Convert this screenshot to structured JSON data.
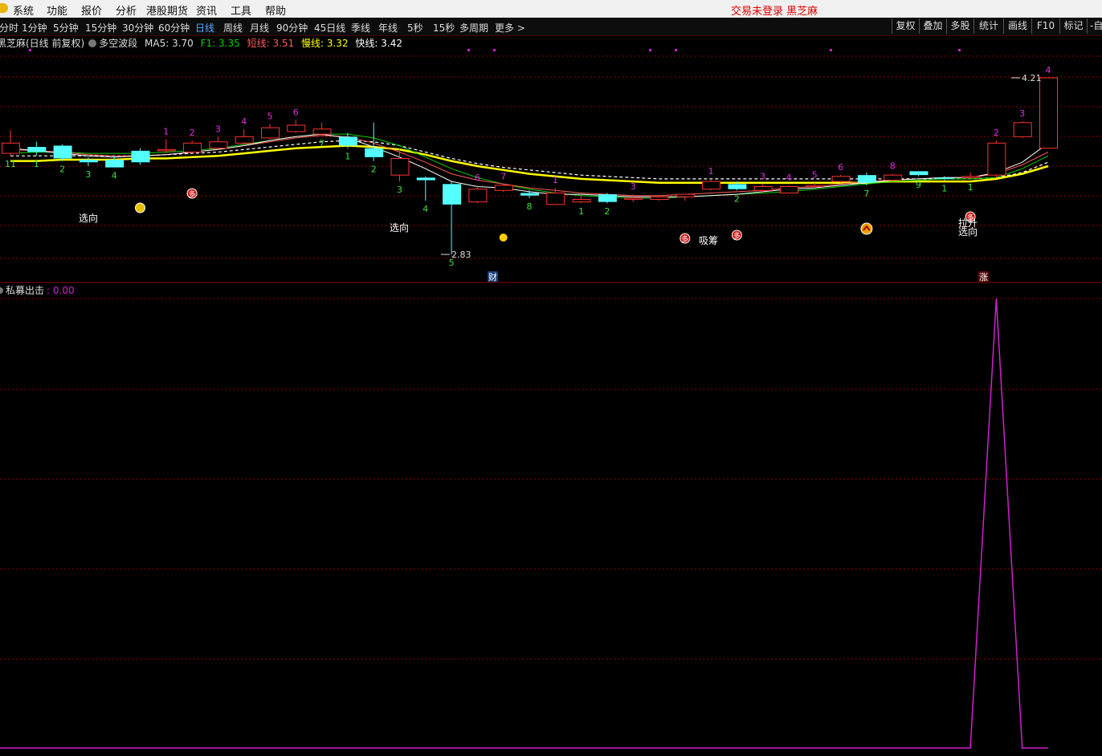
{
  "menubar": {
    "items": [
      "系统",
      "功能",
      "报价",
      "分析",
      "港股期货",
      "资讯",
      "工具",
      "帮助"
    ],
    "status_text": "交易未登录 黑芝麻"
  },
  "toolbar": {
    "periods": [
      "分时",
      "1分钟",
      "5分钟",
      "15分钟",
      "30分钟",
      "60分钟",
      "日线",
      "周线",
      "月线",
      "90分钟",
      "45日线",
      "季线",
      "年线",
      "5秒",
      "15秒",
      "多周期",
      "更多 >"
    ],
    "active": "日线",
    "right_buttons": [
      "复权",
      "叠加",
      "多股",
      "统计",
      "画线",
      "F10",
      "标记",
      "-自"
    ]
  },
  "info": {
    "title": "黑芝麻(日线 前复权)",
    "indicator_name": "多空波段",
    "ma5": "MA5: 3.70",
    "f1": "F1: 3.35",
    "short": "短线: 3.51",
    "slow": "慢线: 3.32",
    "fast": "快线: 3.42"
  },
  "colors": {
    "up": "#ff3232",
    "down": "#54ffff",
    "ma5": "#ffffff",
    "f1": "#00d000",
    "short_line": "#ff5a5a",
    "slow_line": "#ffff00",
    "fast_line": "#ffffff",
    "signal_line": "#d020d0",
    "grid": "#8b0000"
  },
  "chart": {
    "high_label": "4.21",
    "low_label": "2.83",
    "marker_cai": "财",
    "marker_zhang": "涨"
  },
  "indicator": {
    "name": "私募出击",
    "value": ": 0.00"
  },
  "chart_data": {
    "type": "candlestick",
    "price_high": 4.21,
    "price_low": 2.83,
    "candles": [
      {
        "o": 3.7,
        "h": 3.8,
        "l": 3.6,
        "c": 3.62,
        "label": "11",
        "tone": "up"
      },
      {
        "o": 3.63,
        "h": 3.71,
        "l": 3.6,
        "c": 3.67,
        "label": "1",
        "tone": "down"
      },
      {
        "o": 3.68,
        "h": 3.69,
        "l": 3.56,
        "c": 3.58,
        "label": "2",
        "tone": "down"
      },
      {
        "o": 3.57,
        "h": 3.59,
        "l": 3.52,
        "c": 3.55,
        "label": "3",
        "tone": "down"
      },
      {
        "o": 3.51,
        "h": 3.6,
        "l": 3.51,
        "c": 3.57,
        "label": "4",
        "tone": "down"
      },
      {
        "o": 3.55,
        "h": 3.66,
        "l": 3.53,
        "c": 3.64,
        "label": "",
        "tone": "down"
      },
      {
        "o": 3.64,
        "h": 3.73,
        "l": 3.62,
        "c": 3.65,
        "label": "1",
        "tone": "up"
      },
      {
        "o": 3.63,
        "h": 3.72,
        "l": 3.62,
        "c": 3.7,
        "label": "2",
        "tone": "up"
      },
      {
        "o": 3.66,
        "h": 3.75,
        "l": 3.65,
        "c": 3.71,
        "label": "3",
        "tone": "up"
      },
      {
        "o": 3.7,
        "h": 3.81,
        "l": 3.68,
        "c": 3.75,
        "label": "4",
        "tone": "up"
      },
      {
        "o": 3.74,
        "h": 3.85,
        "l": 3.73,
        "c": 3.82,
        "label": "5",
        "tone": "up"
      },
      {
        "o": 3.79,
        "h": 3.88,
        "l": 3.78,
        "c": 3.84,
        "label": "6",
        "tone": "up"
      },
      {
        "o": 3.81,
        "h": 3.86,
        "l": 3.76,
        "c": 3.77,
        "label": "7",
        "tone": "up"
      },
      {
        "o": 3.75,
        "h": 3.78,
        "l": 3.66,
        "c": 3.68,
        "label": "1",
        "tone": "down"
      },
      {
        "o": 3.66,
        "h": 3.86,
        "l": 3.56,
        "c": 3.59,
        "label": "2",
        "tone": "down"
      },
      {
        "o": 3.58,
        "h": 3.66,
        "l": 3.4,
        "c": 3.45,
        "label": "3",
        "tone": "up"
      },
      {
        "o": 3.43,
        "h": 3.44,
        "l": 3.25,
        "c": 3.41,
        "label": "4",
        "tone": "down"
      },
      {
        "o": 3.38,
        "h": 3.4,
        "l": 2.83,
        "c": 3.22,
        "label": "5",
        "tone": "down"
      },
      {
        "o": 3.24,
        "h": 3.37,
        "l": 3.23,
        "c": 3.34,
        "label": "6",
        "tone": "up"
      },
      {
        "o": 3.33,
        "h": 3.38,
        "l": 3.32,
        "c": 3.37,
        "label": "7",
        "tone": "up"
      },
      {
        "o": 3.31,
        "h": 3.33,
        "l": 3.27,
        "c": 3.29,
        "label": "8",
        "tone": "down"
      },
      {
        "o": 3.22,
        "h": 3.35,
        "l": 3.22,
        "c": 3.31,
        "label": "1",
        "tone": "up"
      },
      {
        "o": 3.26,
        "h": 3.29,
        "l": 3.23,
        "c": 3.24,
        "label": "1",
        "tone": "up"
      },
      {
        "o": 3.24,
        "h": 3.31,
        "l": 3.23,
        "c": 3.3,
        "label": "2",
        "tone": "down"
      },
      {
        "o": 3.27,
        "h": 3.3,
        "l": 3.24,
        "c": 3.27,
        "label": "3",
        "tone": "up"
      },
      {
        "o": 3.26,
        "h": 3.29,
        "l": 3.25,
        "c": 3.28,
        "label": "",
        "tone": "up"
      },
      {
        "o": 3.28,
        "h": 3.3,
        "l": 3.25,
        "c": 3.3,
        "label": "",
        "tone": "up"
      },
      {
        "o": 3.34,
        "h": 3.42,
        "l": 3.33,
        "c": 3.4,
        "label": "1",
        "tone": "up"
      },
      {
        "o": 3.38,
        "h": 3.4,
        "l": 3.33,
        "c": 3.34,
        "label": "2",
        "tone": "down"
      },
      {
        "o": 3.33,
        "h": 3.38,
        "l": 3.31,
        "c": 3.36,
        "label": "3",
        "tone": "up"
      },
      {
        "o": 3.31,
        "h": 3.37,
        "l": 3.31,
        "c": 3.36,
        "label": "4",
        "tone": "up"
      },
      {
        "o": 3.36,
        "h": 3.39,
        "l": 3.35,
        "c": 3.37,
        "label": "5",
        "tone": "up"
      },
      {
        "o": 3.4,
        "h": 3.45,
        "l": 3.39,
        "c": 3.44,
        "label": "6",
        "tone": "up"
      },
      {
        "o": 3.45,
        "h": 3.47,
        "l": 3.37,
        "c": 3.39,
        "label": "7",
        "tone": "down"
      },
      {
        "o": 3.41,
        "h": 3.46,
        "l": 3.4,
        "c": 3.45,
        "label": "8",
        "tone": "up"
      },
      {
        "o": 3.45,
        "h": 3.48,
        "l": 3.44,
        "c": 3.48,
        "label": "9",
        "tone": "down"
      },
      {
        "o": 3.43,
        "h": 3.44,
        "l": 3.41,
        "c": 3.43,
        "label": "1",
        "tone": "down"
      },
      {
        "o": 3.44,
        "h": 3.47,
        "l": 3.42,
        "c": 3.43,
        "label": "1",
        "tone": "up"
      },
      {
        "o": 3.45,
        "h": 3.72,
        "l": 3.43,
        "c": 3.7,
        "label": "2",
        "tone": "up"
      },
      {
        "o": 3.75,
        "h": 3.87,
        "l": 3.74,
        "c": 3.86,
        "label": "3",
        "tone": "up"
      },
      {
        "o": 3.66,
        "h": 4.21,
        "l": 3.66,
        "c": 4.21,
        "label": "4",
        "tone": "up"
      }
    ],
    "ma5": [
      3.66,
      3.64,
      3.62,
      3.6,
      3.59,
      3.6,
      3.61,
      3.63,
      3.65,
      3.68,
      3.72,
      3.75,
      3.77,
      3.74,
      3.67,
      3.59,
      3.5,
      3.4,
      3.36,
      3.35,
      3.32,
      3.3,
      3.3,
      3.29,
      3.28,
      3.28,
      3.28,
      3.29,
      3.3,
      3.32,
      3.34,
      3.35,
      3.37,
      3.39,
      3.41,
      3.42,
      3.43,
      3.43,
      3.47,
      3.55,
      3.7
    ],
    "f1": [
      3.62,
      3.63,
      3.63,
      3.62,
      3.62,
      3.62,
      3.63,
      3.64,
      3.66,
      3.69,
      3.72,
      3.75,
      3.77,
      3.77,
      3.74,
      3.68,
      3.59,
      3.5,
      3.43,
      3.38,
      3.34,
      3.31,
      3.29,
      3.28,
      3.27,
      3.27,
      3.28,
      3.29,
      3.3,
      3.31,
      3.32,
      3.34,
      3.36,
      3.38,
      3.4,
      3.41,
      3.42,
      3.42,
      3.43,
      3.5,
      3.6
    ],
    "short_line": [
      3.65,
      3.64,
      3.63,
      3.61,
      3.6,
      3.6,
      3.61,
      3.63,
      3.65,
      3.68,
      3.71,
      3.74,
      3.76,
      3.75,
      3.7,
      3.63,
      3.55,
      3.46,
      3.41,
      3.38,
      3.35,
      3.33,
      3.31,
      3.3,
      3.29,
      3.29,
      3.3,
      3.31,
      3.32,
      3.33,
      3.35,
      3.36,
      3.38,
      3.4,
      3.41,
      3.42,
      3.43,
      3.43,
      3.46,
      3.53,
      3.63
    ],
    "fast_line": [
      3.6,
      3.6,
      3.6,
      3.6,
      3.6,
      3.6,
      3.61,
      3.62,
      3.63,
      3.65,
      3.67,
      3.69,
      3.71,
      3.72,
      3.71,
      3.68,
      3.63,
      3.58,
      3.54,
      3.51,
      3.49,
      3.47,
      3.45,
      3.44,
      3.43,
      3.42,
      3.42,
      3.42,
      3.42,
      3.42,
      3.42,
      3.42,
      3.42,
      3.42,
      3.42,
      3.42,
      3.42,
      3.42,
      3.43,
      3.47,
      3.55
    ],
    "slow_line": [
      3.56,
      3.56,
      3.57,
      3.57,
      3.57,
      3.58,
      3.58,
      3.59,
      3.6,
      3.62,
      3.64,
      3.66,
      3.67,
      3.68,
      3.67,
      3.65,
      3.61,
      3.56,
      3.52,
      3.49,
      3.46,
      3.44,
      3.42,
      3.41,
      3.4,
      3.39,
      3.39,
      3.39,
      3.39,
      3.39,
      3.39,
      3.39,
      3.39,
      3.39,
      3.4,
      3.4,
      3.4,
      3.4,
      3.42,
      3.46,
      3.52
    ],
    "indicator_values": [
      0,
      0,
      0,
      0,
      0,
      0,
      0,
      0,
      0,
      0,
      0,
      0,
      0,
      0,
      0,
      0,
      0,
      0,
      0,
      0,
      0,
      0,
      0,
      0,
      0,
      0,
      0,
      0,
      0,
      0,
      0,
      0,
      0,
      0,
      0,
      0,
      0,
      0,
      1,
      0,
      0
    ],
    "annotations": {
      "xuanxiang": "选向",
      "xichou": "吸筹",
      "lasheng": "拉升",
      "duo": "多"
    }
  }
}
